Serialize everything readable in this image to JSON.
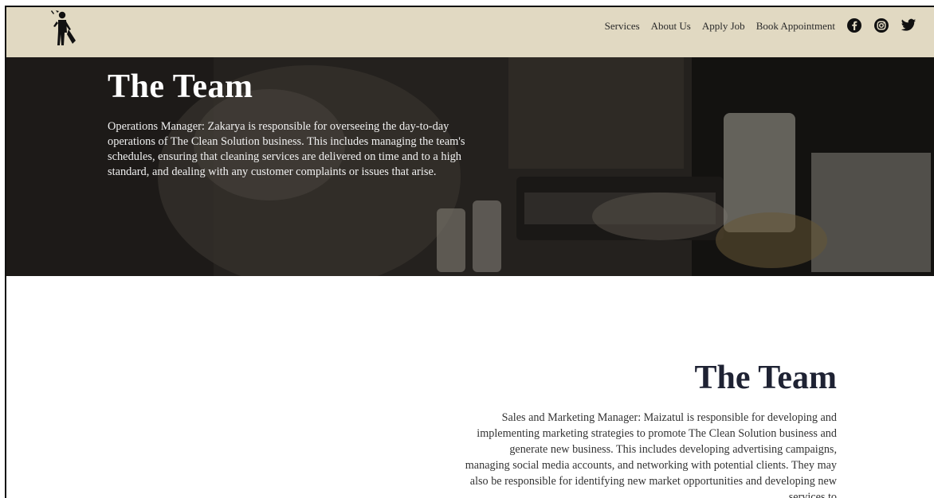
{
  "nav": {
    "items": [
      {
        "label": "Services"
      },
      {
        "label": "About Us"
      },
      {
        "label": "Apply Job"
      },
      {
        "label": "Book Appointment"
      }
    ]
  },
  "social": {
    "facebook": "facebook-icon",
    "instagram": "instagram-icon",
    "twitter": "twitter-icon"
  },
  "hero": {
    "title": "The Team",
    "text": "Operations Manager: Zakarya is responsible for overseeing the day-to-day operations of The Clean Solution business. This includes managing the team's schedules, ensuring that cleaning services are delivered on time and to a high standard, and dealing with any customer complaints or issues that arise."
  },
  "section2": {
    "title": "The Team",
    "text": "Sales and Marketing Manager: Maizatul is responsible for developing and implementing marketing strategies to promote The Clean Solution business and generate new business. This includes developing advertising campaigns, managing social media accounts, and networking with potential clients. They may also be responsible for identifying new market opportunities and developing new services to"
  },
  "colors": {
    "header_bg": "#e1d9c2",
    "text_dark": "#1e2233"
  }
}
